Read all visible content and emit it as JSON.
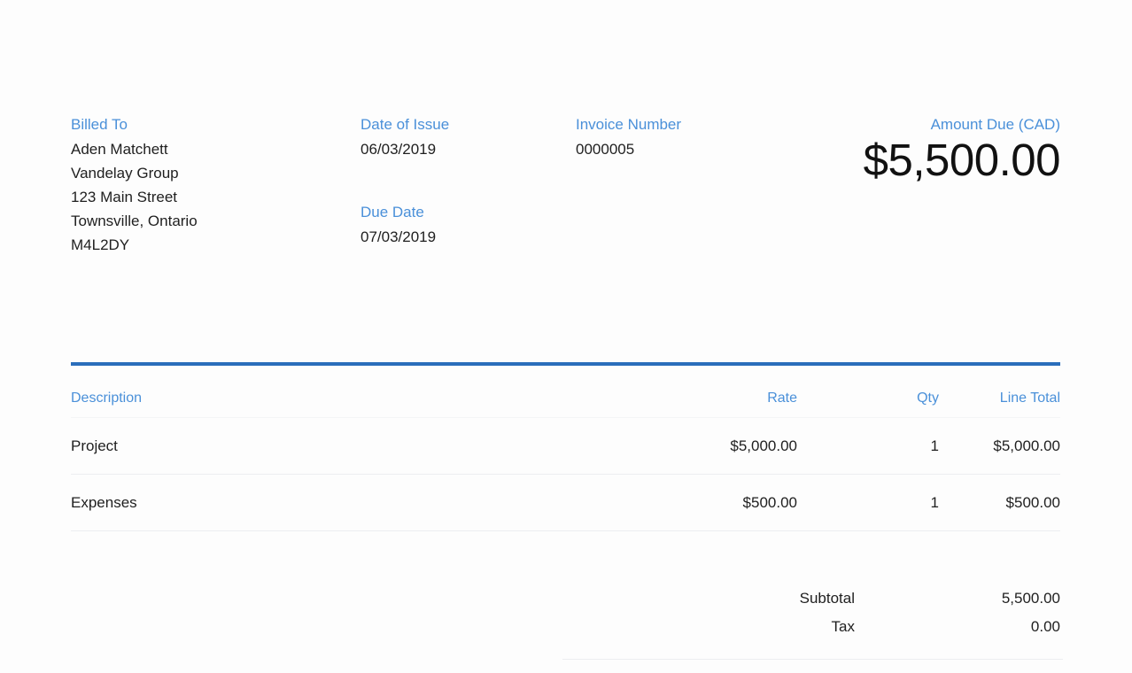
{
  "theme": {
    "label_blue": "#4a90d9",
    "rule_blue": "#2a6ebb",
    "text": "#1f1f1f",
    "divider": "#eceef0",
    "background": "#fdfdfd"
  },
  "billed_to": {
    "label": "Billed To",
    "lines": [
      "Aden Matchett",
      "Vandelay Group",
      "123 Main Street",
      "Townsville, Ontario",
      "M4L2DY"
    ]
  },
  "date_of_issue": {
    "label": "Date of Issue",
    "value": "06/03/2019"
  },
  "due_date": {
    "label": "Due Date",
    "value": "07/03/2019"
  },
  "invoice_number": {
    "label": "Invoice Number",
    "value": "0000005"
  },
  "amount_due": {
    "label": "Amount Due (CAD)",
    "value": "$5,500.00"
  },
  "items_table": {
    "headers": {
      "description": "Description",
      "rate": "Rate",
      "qty": "Qty",
      "line_total": "Line Total"
    },
    "rows": [
      {
        "description": "Project",
        "rate": "$5,000.00",
        "qty": "1",
        "line_total": "$5,000.00"
      },
      {
        "description": "Expenses",
        "rate": "$500.00",
        "qty": "1",
        "line_total": "$500.00"
      }
    ]
  },
  "totals": {
    "rows": [
      {
        "label": "Subtotal",
        "value": "5,500.00"
      },
      {
        "label": "Tax",
        "value": "0.00"
      }
    ]
  }
}
